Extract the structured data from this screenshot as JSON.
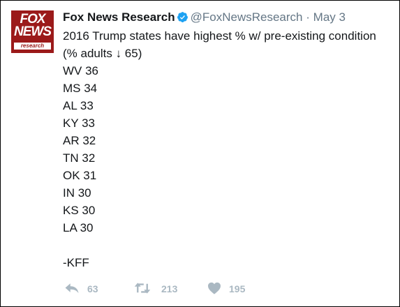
{
  "tweet": {
    "display_name": "Fox News Research",
    "handle": "@FoxNewsResearch",
    "separator": "·",
    "date": "May 3",
    "avatar": {
      "line1": "FOX",
      "line2": "NEWS",
      "line3": "research"
    },
    "text_lines": [
      "2016 Trump states have highest % w/ pre-existing condition",
      "(% adults ↓ 65)",
      "WV 36",
      "MS 34",
      "AL 33",
      "KY 33",
      "AR 32",
      "TN 32",
      "OK 31",
      "IN 30",
      "KS 30",
      "LA 30",
      "",
      "-KFF"
    ]
  },
  "actions": {
    "reply_icon": "reply-icon",
    "reply_count": "63",
    "retweet_icon": "retweet-icon",
    "retweet_count": "213",
    "like_icon": "heart-icon",
    "like_count": "195"
  },
  "colors": {
    "verified_badge": "#1da1f2",
    "avatar_background": "#9b1a1a",
    "muted_text": "#657786",
    "action_icon": "#aab8c2"
  }
}
